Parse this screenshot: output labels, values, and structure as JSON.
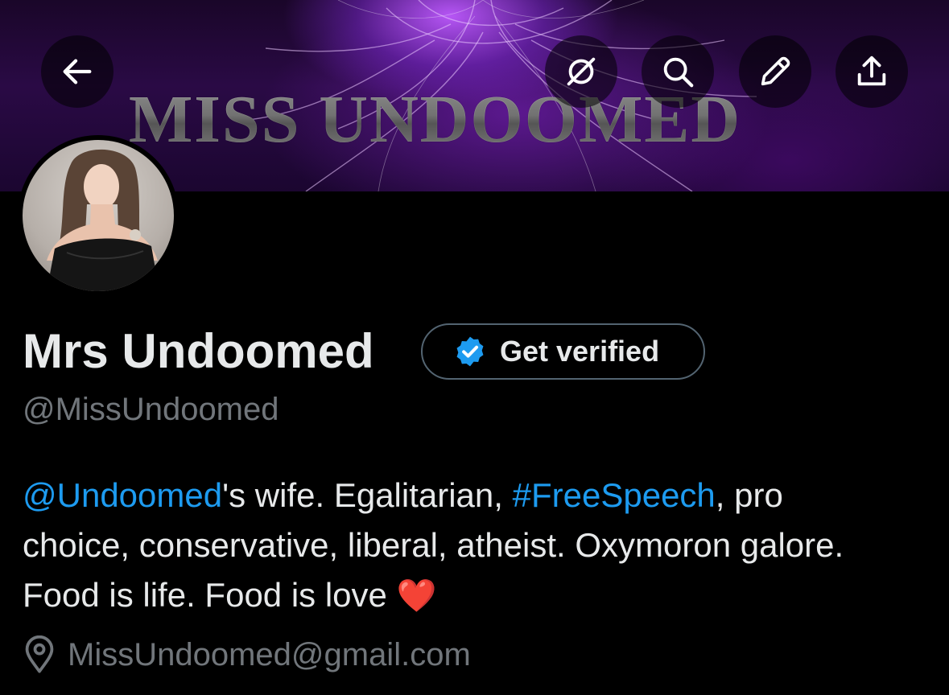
{
  "banner": {
    "title": "MISS UNDOOMED"
  },
  "header_buttons": {
    "back": "back-arrow-icon",
    "mute": "mute-icon",
    "search": "search-icon",
    "edit": "edit-pencil-icon",
    "share": "share-icon"
  },
  "profile": {
    "display_name": "Mrs Undoomed",
    "get_verified_label": "Get verified",
    "handle": "@MissUndoomed",
    "bio": {
      "mention": "@Undoomed",
      "part1": "'s wife. Egalitarian, ",
      "hashtag": "#FreeSpeech",
      "part2": ", pro",
      "line2": "choice, conservative, liberal, atheist. Oxymoron galore.",
      "line3": "Food is life. Food is love ",
      "emoji": "❤️"
    },
    "location": "MissUndoomed@gmail.com"
  },
  "colors": {
    "background": "#000000",
    "link": "#1d9bf0",
    "secondary_text": "#71767b",
    "verified_badge": "#1d9bf0"
  }
}
